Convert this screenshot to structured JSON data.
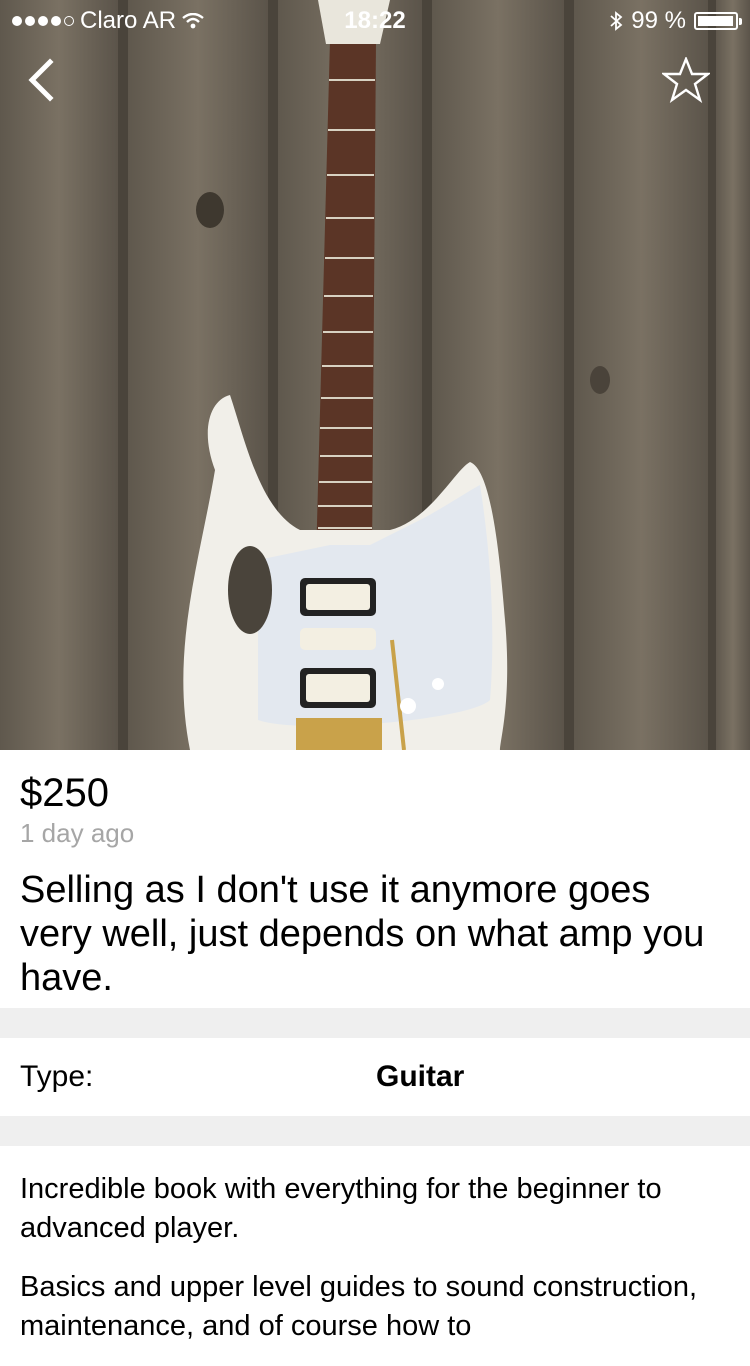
{
  "status_bar": {
    "carrier": "Claro AR",
    "time": "18:22",
    "battery": "99 %"
  },
  "listing": {
    "price": "$250",
    "posted": "1 day ago",
    "title": "Selling as I don't use it anymore goes very well, just depends on what amp you have.",
    "attributes": [
      {
        "label": "Type:",
        "value": "Guitar"
      }
    ],
    "description": [
      "Incredible book with everything for the beginner to advanced player.",
      "Basics and upper level guides to sound construction, maintenance, and of course how to"
    ]
  },
  "icons": {
    "back": "back-chevron-icon",
    "favorite": "star-outline-icon"
  },
  "colors": {
    "separator": "#efefef",
    "muted_text": "#a6a6a6"
  }
}
